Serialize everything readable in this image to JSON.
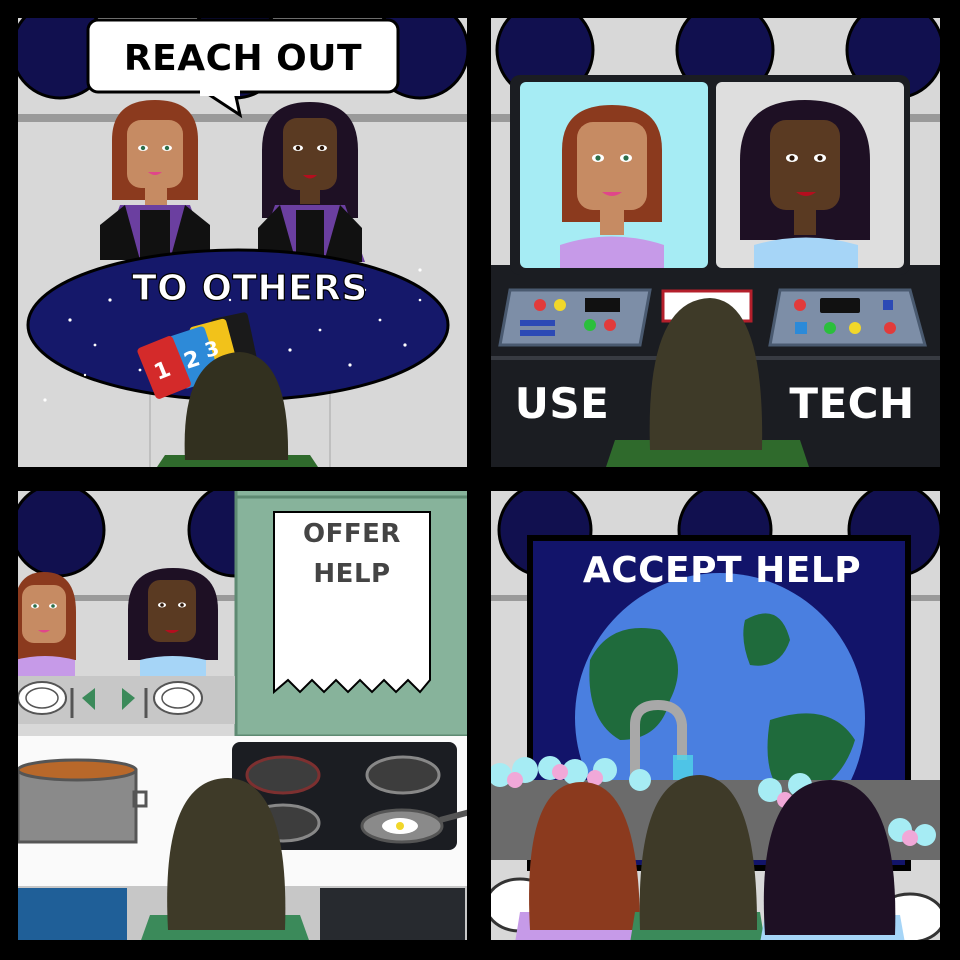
{
  "panels": {
    "p1": {
      "bubble_text": "Reach Out",
      "table_text": "To Others",
      "cards": [
        "1",
        "2",
        "3"
      ]
    },
    "p2": {
      "left_text": "Use",
      "right_text": "Tech"
    },
    "p3": {
      "note_line1": "Offer",
      "note_line2": "Help"
    },
    "p4": {
      "screen_text": "Accept Help"
    }
  },
  "colors": {
    "border": "#000000",
    "wall": "#d3d3d3",
    "porthole": "#11104f",
    "table_space": "#15186a",
    "tech_console": "#1b1d22",
    "kitchen_wall": "#87b39b",
    "earth_ocean": "#4a7fe0",
    "earth_land": "#1f6b3c"
  },
  "icons": [
    "speech-bubble-icon",
    "playing-card-icon",
    "video-screen-icon",
    "cooking-pot-icon",
    "frying-pan-icon",
    "faucet-icon",
    "earth-globe-icon"
  ]
}
